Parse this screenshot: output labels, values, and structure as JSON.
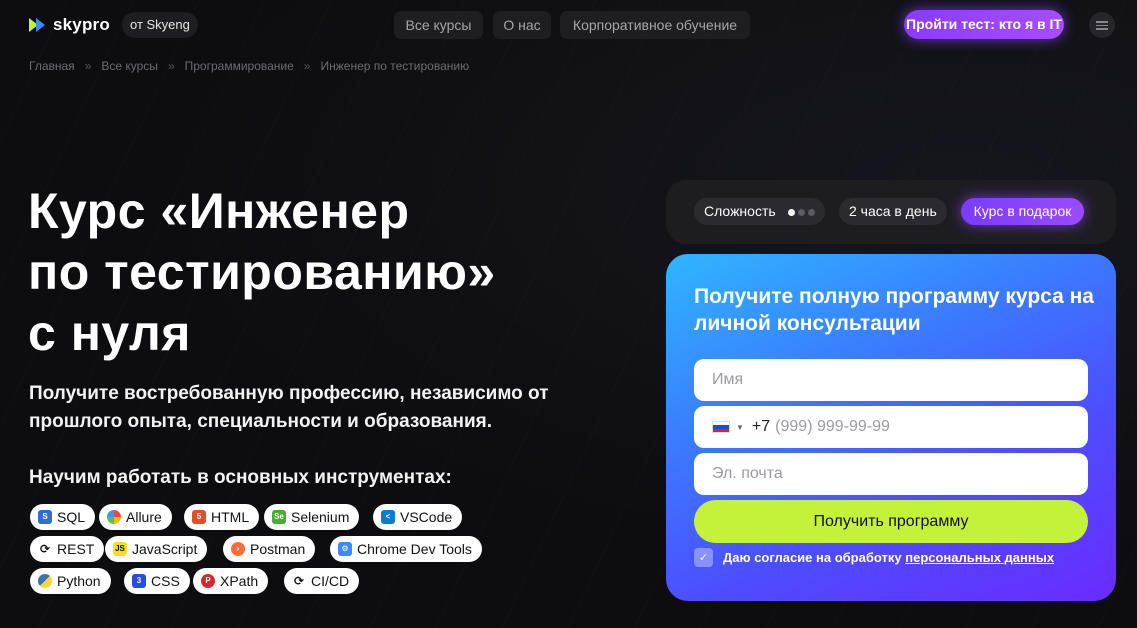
{
  "header": {
    "logo_text": "skypro",
    "brand_label": "от Skyeng",
    "nav": [
      "Все курсы",
      "О нас",
      "Корпоративное обучение"
    ],
    "cta": "Пройти тест: кто я в IT"
  },
  "breadcrumb": [
    "Главная",
    "Все курсы",
    "Программирование",
    "Инженер по тестированию"
  ],
  "hero": {
    "title_line1": "Курс «Инженер",
    "title_line2": "по тестированию»",
    "title_line3": "с нуля",
    "subtitle": "Получите востребованную профессию, независимо от прошлого опыта, специальности и образования.",
    "tools_heading": "Научим работать в основных инструментах:",
    "tools": [
      "SQL",
      "Allure",
      "HTML",
      "Selenium",
      "VSCode",
      "REST",
      "JavaScript",
      "Postman",
      "Chrome Dev Tools",
      "Python",
      "CSS",
      "XPath",
      "CI/CD"
    ]
  },
  "info": {
    "difficulty_label": "Сложность",
    "difficulty_level": 1,
    "difficulty_max": 3,
    "hours": "2 часа в день",
    "gift": "Курс в подарок"
  },
  "form": {
    "title": "Получите полную программу курса на личной консультации",
    "name_placeholder": "Имя",
    "phone_prefix": "+7",
    "phone_placeholder": "(999) 999-99-99",
    "email_placeholder": "Эл. почта",
    "submit_label": "Получить программу",
    "consent_text": "Даю согласие на обработку",
    "consent_link": "персональных данных"
  },
  "colors": {
    "accent_lime": "#c4f23b",
    "accent_purple": "#8a3bff",
    "form_gradient_start": "#2fb6ff",
    "form_gradient_end": "#6a2bff"
  }
}
